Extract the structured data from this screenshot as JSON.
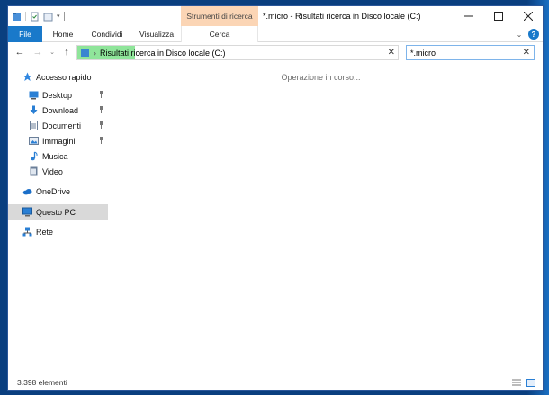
{
  "window": {
    "title": "*.micro - Risultati ricerca in Disco locale (C:)",
    "tool_tab_label": "Strumenti di ricerca"
  },
  "ribbon": {
    "tabs": [
      "File",
      "Home",
      "Condividi",
      "Visualizza",
      "Cerca"
    ]
  },
  "address": {
    "location": "Risultati ricerca in Disco locale (C:)"
  },
  "search": {
    "query": "*.micro"
  },
  "sidebar": {
    "items": [
      {
        "label": "Accesso rapido",
        "icon": "star-icon"
      },
      {
        "label": "Desktop",
        "icon": "desktop-icon",
        "pinned": true
      },
      {
        "label": "Download",
        "icon": "download-icon",
        "pinned": true
      },
      {
        "label": "Documenti",
        "icon": "documents-icon",
        "pinned": true
      },
      {
        "label": "Immagini",
        "icon": "pictures-icon",
        "pinned": true
      },
      {
        "label": "Musica",
        "icon": "music-icon"
      },
      {
        "label": "Video",
        "icon": "video-icon"
      },
      {
        "label": "OneDrive",
        "icon": "cloud-icon"
      },
      {
        "label": "Questo PC",
        "icon": "computer-icon",
        "selected": true
      },
      {
        "label": "Rete",
        "icon": "network-icon"
      }
    ]
  },
  "content": {
    "message": "Operazione in corso..."
  },
  "status": {
    "count": "3.398 elementi"
  },
  "colors": {
    "accent": "#1979ca",
    "tool_tab": "#fbd5b5",
    "progress": "#8fe59a"
  }
}
